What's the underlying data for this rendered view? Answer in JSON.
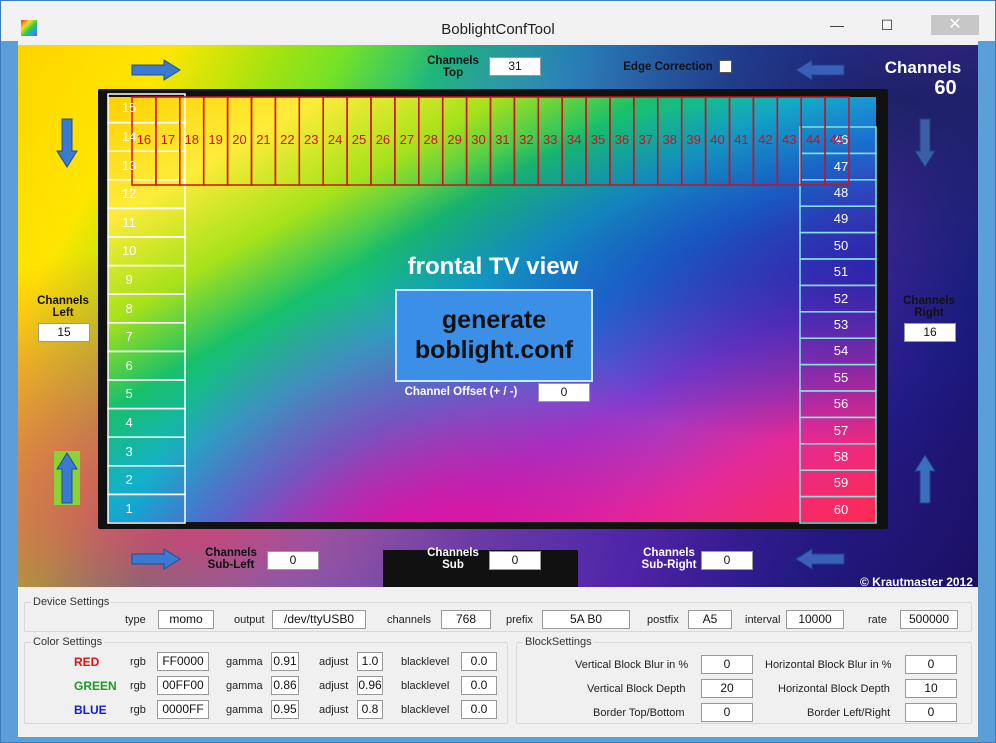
{
  "window": {
    "title": "BoblightConfTool",
    "minimize": "—",
    "maximize": "☐",
    "close": "✕",
    "app_icon": "colorful-square-icon"
  },
  "top": {
    "channels_top_label": "Channels Top",
    "channels_top_value": "31",
    "edge_correction_label": "Edge Correction",
    "edge_correction_checked": false,
    "total_label": "Channels",
    "total_value": "60"
  },
  "sides": {
    "channels_left_label": "Channels Left",
    "channels_left_value": "15",
    "channels_right_label": "Channels Right",
    "channels_right_value": "16"
  },
  "bottom": {
    "sub_left_label": "Channels Sub-Left",
    "sub_left_value": "0",
    "sub_label": "Channels Sub",
    "sub_value": "0",
    "sub_right_label": "Channels Sub-Right",
    "sub_right_value": "0"
  },
  "center": {
    "caption": "frontal TV view",
    "generate_line1": "generate",
    "generate_line2": "boblight.conf",
    "offset_label": "Channel Offset (+ / -)",
    "offset_value": "0"
  },
  "copyright": "© Krautmaster 2012",
  "leds": {
    "left": [
      "1",
      "2",
      "3",
      "4",
      "5",
      "6",
      "7",
      "8",
      "9",
      "10",
      "11",
      "12",
      "13",
      "14",
      "15"
    ],
    "top": [
      "16",
      "17",
      "18",
      "19",
      "20",
      "21",
      "22",
      "23",
      "24",
      "25",
      "26",
      "27",
      "28",
      "29",
      "30",
      "31",
      "32",
      "33",
      "34",
      "35",
      "36",
      "37",
      "38",
      "39",
      "40",
      "41",
      "42",
      "43",
      "44",
      "45"
    ],
    "right": [
      "46",
      "47",
      "48",
      "49",
      "50",
      "51",
      "52",
      "53",
      "54",
      "55",
      "56",
      "57",
      "58",
      "59",
      "60"
    ],
    "colors": {
      "top_outline": "#d0101a",
      "side_outline": "#ffffff",
      "right_outline": "#7fe3d8",
      "active_arrow_bg": "#8cd234"
    }
  },
  "device": {
    "title": "Device Settings",
    "type_label": "type",
    "type_value": "momo",
    "output_label": "output",
    "output_value": "/dev/ttyUSB0",
    "channels_label": "channels",
    "channels_value": "768",
    "prefix_label": "prefix",
    "prefix_value": "5A B0",
    "postfix_label": "postfix",
    "postfix_value": "A5",
    "interval_label": "interval",
    "interval_value": "10000",
    "rate_label": "rate",
    "rate_value": "500000"
  },
  "color": {
    "title": "Color Settings",
    "rows": [
      {
        "name": "RED",
        "color": "#e0101a",
        "rgb_label": "rgb",
        "rgb": "FF0000",
        "gamma_label": "gamma",
        "gamma": "0.91",
        "adjust_label": "adjust",
        "adjust": "1.0",
        "black_label": "blacklevel",
        "black": "0.0"
      },
      {
        "name": "GREEN",
        "color": "#1f9a22",
        "rgb_label": "rgb",
        "rgb": "00FF00",
        "gamma_label": "gamma",
        "gamma": "0.86",
        "adjust_label": "adjust",
        "adjust": "0.96",
        "black_label": "blacklevel",
        "black": "0.0"
      },
      {
        "name": "BLUE",
        "color": "#1020d0",
        "rgb_label": "rgb",
        "rgb": "0000FF",
        "gamma_label": "gamma",
        "gamma": "0.95",
        "adjust_label": "adjust",
        "adjust": "0.8",
        "black_label": "blacklevel",
        "black": "0.0"
      }
    ]
  },
  "block": {
    "title": "BlockSettings",
    "vblur_label": "Vertical Block Blur in %",
    "vblur": "0",
    "hblur_label": "Horizontal Block Blur in %",
    "hblur": "0",
    "vdepth_label": "Vertical Block Depth",
    "vdepth": "20",
    "hdepth_label": "Horizontal Block Depth",
    "hdepth": "10",
    "border_tb_label": "Border Top/Bottom",
    "border_tb": "0",
    "border_lr_label": "Border Left/Right",
    "border_lr": "0"
  }
}
